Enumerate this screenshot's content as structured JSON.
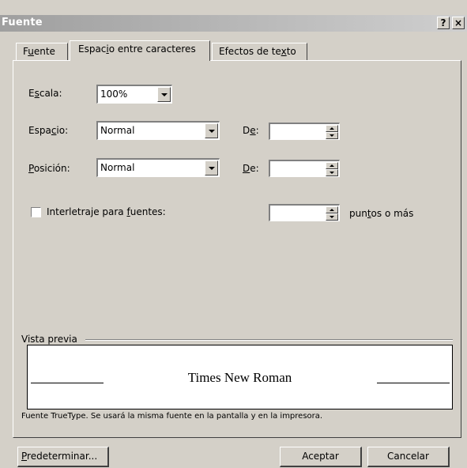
{
  "window": {
    "title": "Fuente",
    "help_label": "?",
    "close_label": "×"
  },
  "tabs": [
    {
      "label_pre": "F",
      "label_u": "u",
      "label_post": "ente",
      "active": false
    },
    {
      "label_pre": "Espac",
      "label_u": "i",
      "label_post": "o entre caracteres",
      "active": true
    },
    {
      "label_pre": "Efectos de te",
      "label_u": "x",
      "label_post": "to",
      "active": false
    }
  ],
  "form": {
    "escala_pre": "E",
    "escala_u": "s",
    "escala_post": "cala:",
    "escala_value": "100%",
    "espacio_pre": "Espa",
    "espacio_u": "c",
    "espacio_post": "io:",
    "espacio_value": "Normal",
    "posicion_pre": "",
    "posicion_u": "P",
    "posicion_post": "osición:",
    "posicion_value": "Normal",
    "de1_pre": "D",
    "de1_u": "e",
    "de1_post": ":",
    "de1_value": "",
    "de2_pre": "",
    "de2_u": "D",
    "de2_post": "e:",
    "de2_value": "",
    "kerning_pre": "Interletraje para ",
    "kerning_u": "f",
    "kerning_post": "uentes:",
    "kerning_checked": false,
    "kerning_value": "",
    "puntos_pre": "pun",
    "puntos_u": "t",
    "puntos_post": "os o más"
  },
  "preview": {
    "group_label": "Vista previa",
    "sample_text": "Times New Roman",
    "note": "Fuente TrueType. Se usará la misma fuente en la pantalla y en la impresora."
  },
  "buttons": {
    "default_pre": "",
    "default_u": "P",
    "default_post": "redeterminar...",
    "ok_label": "Aceptar",
    "cancel_label": "Cancelar"
  }
}
